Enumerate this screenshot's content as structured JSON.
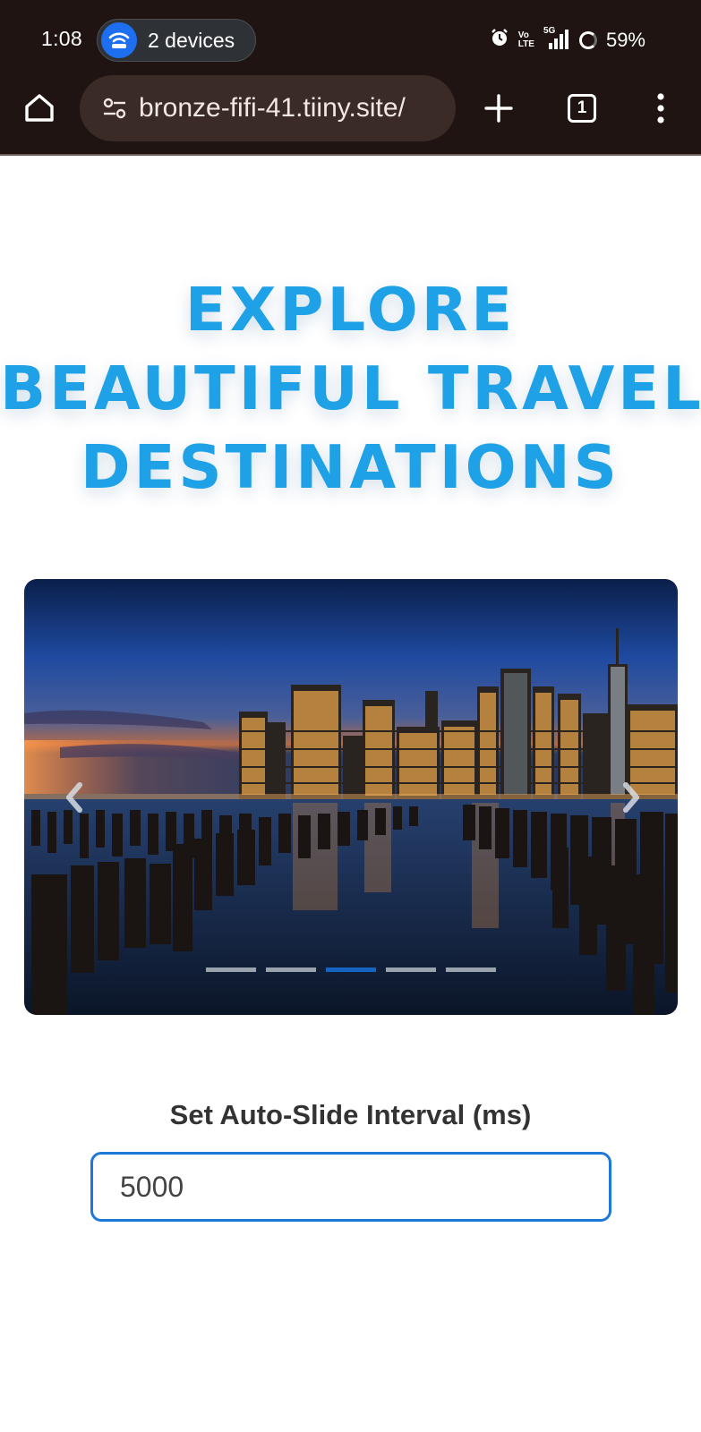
{
  "status_bar": {
    "time": "1:08",
    "devices_label": "2 devices",
    "network_top": "5G",
    "volte_top": "Vo",
    "volte_bottom": "LTE",
    "battery": "59%"
  },
  "browser": {
    "url": "bronze-fifi-41.tiiny.site/",
    "tab_count": "1"
  },
  "page": {
    "heading_lines": [
      "EXPLORE",
      "BEAUTIFUL TRAVEL",
      "DESTINATIONS"
    ],
    "carousel": {
      "slide_count": 5,
      "active_index": 2,
      "prev_glyph": "‹",
      "next_glyph": "›"
    },
    "interval_label": "Set Auto-Slide Interval (ms)",
    "interval_value": "5000"
  },
  "colors": {
    "chrome_bg": "#1f1411",
    "heading": "#1ea1e6",
    "accent": "#1e78d8",
    "active_dot": "#1565c0"
  }
}
